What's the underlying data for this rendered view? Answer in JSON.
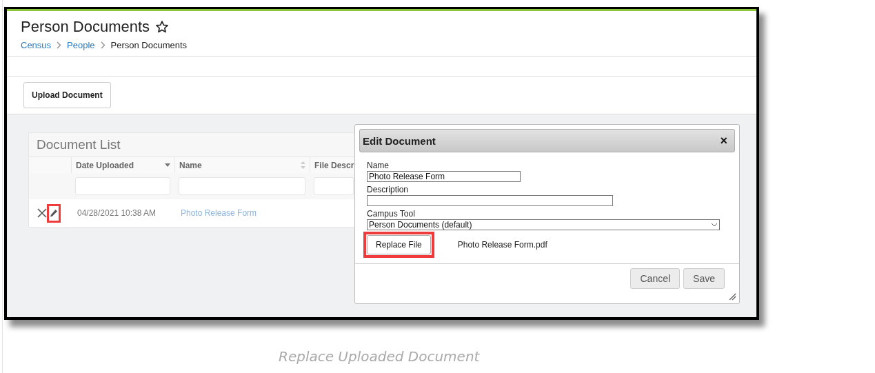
{
  "page": {
    "title": "Person Documents",
    "breadcrumbs": [
      {
        "label": "Census",
        "kind": "link"
      },
      {
        "label": "People",
        "kind": "link"
      },
      {
        "label": "Person Documents",
        "kind": "current"
      }
    ]
  },
  "toolbar": {
    "upload_button": "Upload Document"
  },
  "document_list": {
    "title": "Document List",
    "columns": [
      {
        "label": "Date Uploaded",
        "kind": "sorted"
      },
      {
        "label": "Name",
        "kind": "sortable"
      },
      {
        "label": "File Descr",
        "kind": "plain"
      }
    ],
    "rows": [
      {
        "date": "04/28/2021 10:38 AM",
        "name": "Photo Release Form"
      }
    ]
  },
  "dialog": {
    "title": "Edit Document",
    "close": "×",
    "fields": [
      {
        "label": "Name",
        "value": "Photo Release Form",
        "kind": "text"
      },
      {
        "label": "Description",
        "kind": "text"
      },
      {
        "label": "Campus Tool",
        "value": "Person Documents (default)",
        "kind": "select"
      }
    ],
    "replace_button": "Replace File",
    "file_name": "Photo Release Form.pdf",
    "buttons": [
      "Cancel",
      "Save"
    ]
  },
  "caption": "Replace Uploaded Document"
}
